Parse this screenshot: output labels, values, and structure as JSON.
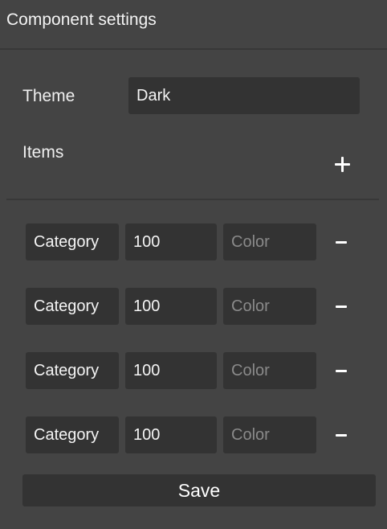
{
  "panel": {
    "title": "Component settings"
  },
  "theme": {
    "label": "Theme",
    "value": "Dark"
  },
  "items": {
    "label": "Items",
    "add_icon": "plus-icon",
    "remove_icon": "minus-icon",
    "rows": [
      {
        "category": "Category",
        "value": "100",
        "color": "",
        "color_placeholder": "Color"
      },
      {
        "category": "Category",
        "value": "100",
        "color": "",
        "color_placeholder": "Color"
      },
      {
        "category": "Category",
        "value": "100",
        "color": "",
        "color_placeholder": "Color"
      },
      {
        "category": "Category",
        "value": "100",
        "color": "",
        "color_placeholder": "Color"
      }
    ]
  },
  "actions": {
    "save_label": "Save"
  },
  "colors": {
    "panel_background": "#444444",
    "field_background": "#333333",
    "divider": "#383838",
    "text": "#f2f2f2",
    "placeholder": "#8a8a8a"
  }
}
